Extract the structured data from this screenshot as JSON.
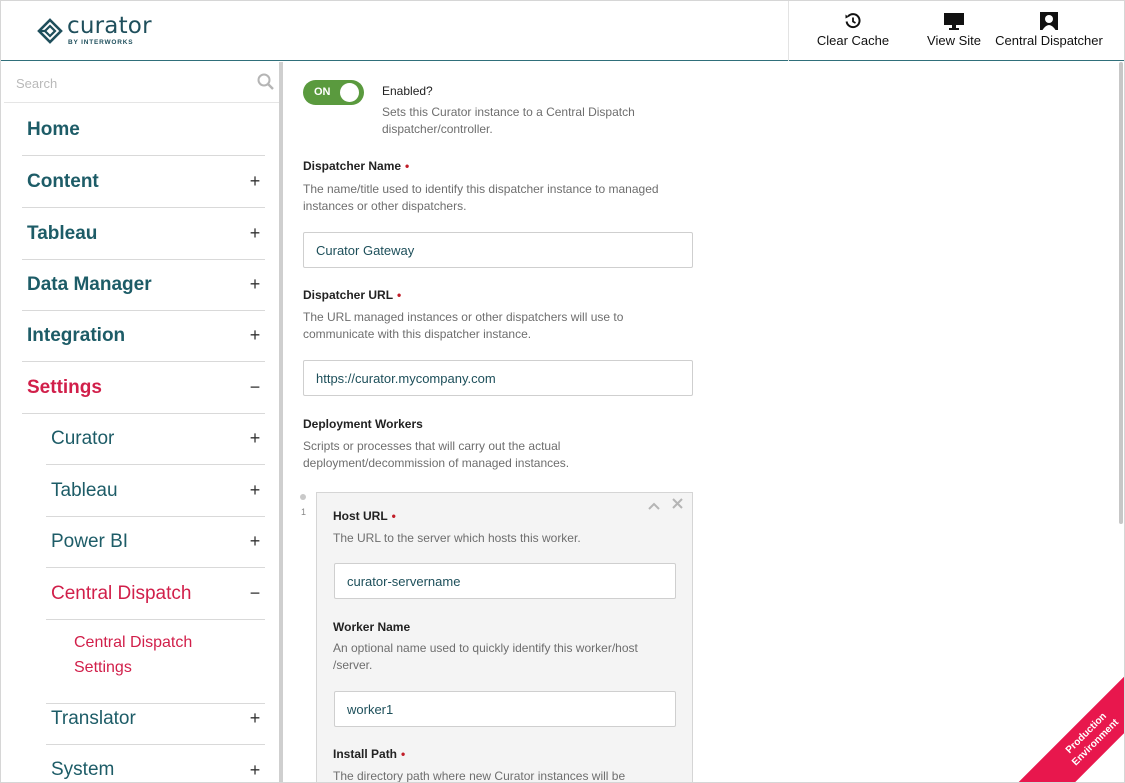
{
  "header": {
    "logo_word": "curator",
    "logo_sub": "BY INTERWORKS",
    "buttons": [
      {
        "label": "Clear Cache",
        "icon": "history-icon"
      },
      {
        "label": "View Site",
        "icon": "monitor-icon"
      },
      {
        "label": "Central Dispatcher",
        "icon": "user-icon"
      }
    ]
  },
  "sidebar": {
    "search_placeholder": "Search",
    "items": [
      {
        "label": "Home",
        "sign": ""
      },
      {
        "label": "Content",
        "sign": "+"
      },
      {
        "label": "Tableau",
        "sign": "+"
      },
      {
        "label": "Data Manager",
        "sign": "+"
      },
      {
        "label": "Integration",
        "sign": "+"
      },
      {
        "label": "Settings",
        "sign": "−"
      }
    ],
    "sub_items": [
      {
        "label": "Curator",
        "sign": "+"
      },
      {
        "label": "Tableau",
        "sign": "+"
      },
      {
        "label": "Power BI",
        "sign": "+"
      },
      {
        "label": "Central Dispatch",
        "sign": "−"
      }
    ],
    "sub_sub_item": {
      "line1": "Central Dispatch",
      "line2": "Settings"
    },
    "sub_items_after": [
      {
        "label": "Translator",
        "sign": "+"
      },
      {
        "label": "System",
        "sign": "+"
      }
    ]
  },
  "form": {
    "enabled": {
      "toggle_text": "ON",
      "label": "Enabled?",
      "help1": "Sets this Curator instance to a Central Dispatch",
      "help2": "dispatcher/controller."
    },
    "dispatcher_name": {
      "label": "Dispatcher Name",
      "required": "•",
      "help1": "The name/title used to identify this dispatcher instance to managed",
      "help2": "instances or other dispatchers.",
      "value": "Curator Gateway"
    },
    "dispatcher_url": {
      "label": "Dispatcher URL",
      "required": "•",
      "help1": "The URL managed instances or other dispatchers will use to",
      "help2": "communicate with this dispatcher instance.",
      "value": "https://curator.mycompany.com"
    },
    "deployment_workers": {
      "label": "Deployment Workers",
      "help1": "Scripts or processes that will carry out the actual",
      "help2": "deployment/decommission of managed instances."
    },
    "worker": {
      "index": "1",
      "host_url": {
        "label": "Host URL",
        "required": "•",
        "help": "The URL to the server which hosts this worker.",
        "value": "curator-servername"
      },
      "worker_name": {
        "label": "Worker Name",
        "help1": "An optional name used to quickly identify this worker/host",
        "help2": "/server.",
        "value": "worker1"
      },
      "install_path": {
        "label": "Install Path",
        "required": "•",
        "help": "The directory path where new Curator instances will be"
      }
    }
  },
  "ribbon": {
    "line1": "Production",
    "line2": "Environment"
  },
  "colors": {
    "brand": "#1d5c67",
    "active": "#d11f4a",
    "toggle_on": "#5a9a3e",
    "ribbon": "#e8174d"
  }
}
